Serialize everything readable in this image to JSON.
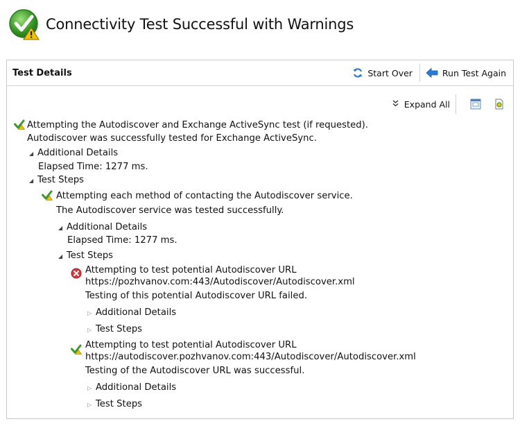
{
  "header": {
    "title": "Connectivity Test Successful with Warnings",
    "icon": "success-warning-icon"
  },
  "panel": {
    "title": "Test Details",
    "start_over": "Start Over",
    "run_again": "Run Test Again",
    "expand_all": "Expand All"
  },
  "tree": {
    "root_title": "Attempting the Autodiscover and Exchange ActiveSync test (if requested).",
    "root_result": "Autodiscover was successfully tested for Exchange ActiveSync.",
    "additional_details": "Additional Details",
    "elapsed_1": "Elapsed Time: 1277 ms.",
    "test_steps": "Test Steps",
    "step1_title": "Attempting each method of contacting the Autodiscover service.",
    "step1_result": "The Autodiscover service was tested successfully.",
    "elapsed_2": "Elapsed Time: 1277 ms.",
    "url_attempt_label": "Attempting to test potential Autodiscover URL",
    "url1": "https://pozhvanov.com:443/Autodiscover/Autodiscover.xml",
    "url1_result": "Testing of this potential Autodiscover URL failed.",
    "url2": "https://autodiscover.pozhvanov.com:443/Autodiscover/Autodiscover.xml",
    "url2_result": "Testing of the Autodiscover URL was successful."
  },
  "colors": {
    "success_green": "#3a9a2a",
    "warning_yellow": "#f2c200",
    "error_red": "#d9363e",
    "accent_blue": "#2b7bd6"
  }
}
